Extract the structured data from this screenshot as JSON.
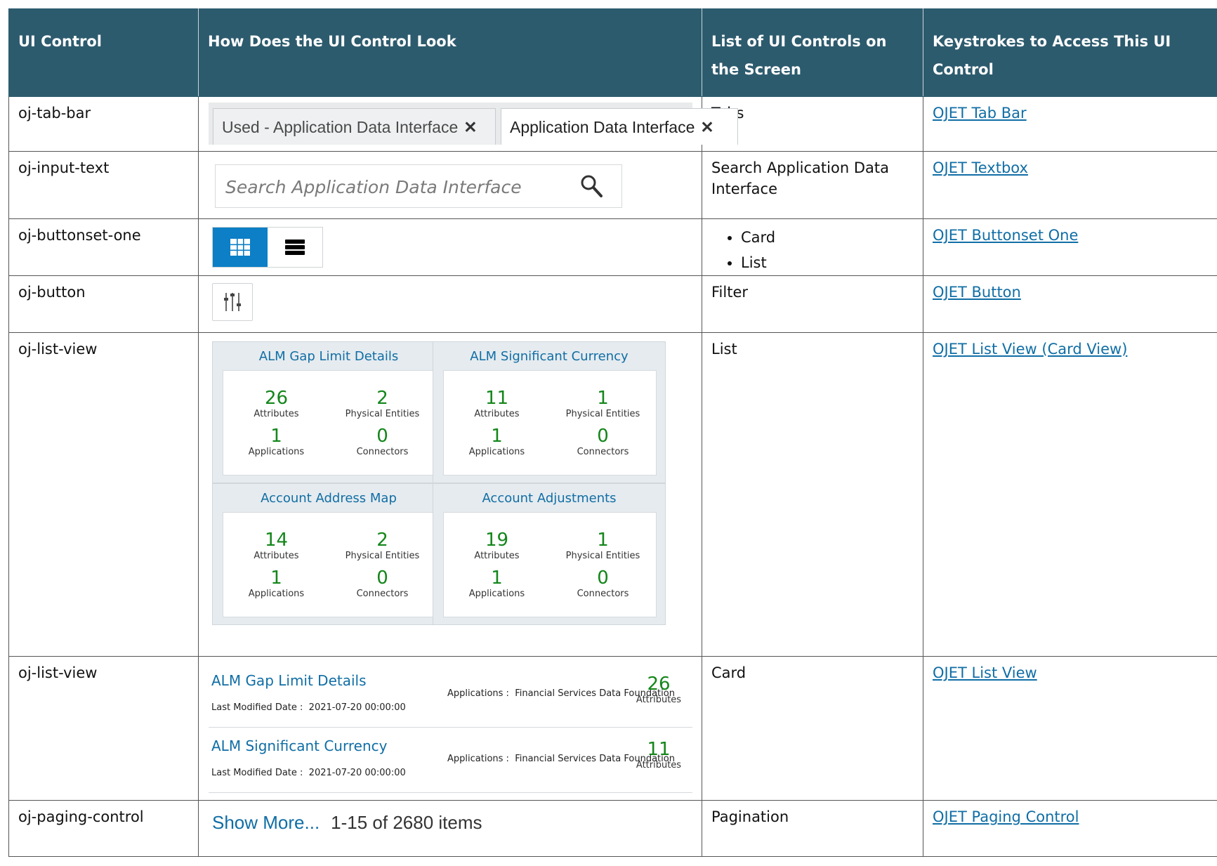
{
  "headers": [
    "UI Control",
    "How Does the UI Control Look",
    "List of UI Controls on the Screen",
    "Keystrokes to Access This UI Control"
  ],
  "rows": [
    {
      "control": "oj-tab-bar",
      "list": "Tabs",
      "link": "OJET Tab Bar"
    },
    {
      "control": "oj-input-text",
      "list": "Search Application Data Interface",
      "link": "OJET Textbox"
    },
    {
      "control": "oj-buttonset-one",
      "list_items": [
        "Card",
        "List"
      ],
      "link": "OJET Buttonset One"
    },
    {
      "control": "oj-button",
      "list": "Filter",
      "link": "OJET Button"
    },
    {
      "control": "oj-list-view",
      "list": "List",
      "link": "OJET List View (Card View)"
    },
    {
      "control": "oj-list-view",
      "list": "Card",
      "link": "OJET List View"
    },
    {
      "control": "oj-paging-control",
      "list": "Pagination",
      "link": "OJET Paging Control"
    }
  ],
  "tabs": [
    {
      "label": "Used - Application Data Interface",
      "close": "✕"
    },
    {
      "label": "Application Data Interface",
      "close": "✕"
    }
  ],
  "search": {
    "placeholder": "Search Application Data Interface",
    "icon": "search-icon"
  },
  "buttonset": {
    "active": "card",
    "icons": [
      "grid-icon",
      "list-icon"
    ],
    "accent": "#0c7fc6"
  },
  "filter": {
    "icon": "sliders-icon"
  },
  "cards": [
    {
      "title": "ALM Gap Limit Details",
      "attributes": "26",
      "physical_entities": "2",
      "applications": "1",
      "connectors": "0"
    },
    {
      "title": "ALM Significant Currency",
      "attributes": "11",
      "physical_entities": "1",
      "applications": "1",
      "connectors": "0"
    },
    {
      "title": "Account Address Map",
      "attributes": "14",
      "physical_entities": "2",
      "applications": "1",
      "connectors": "0"
    },
    {
      "title": "Account Adjustments",
      "attributes": "19",
      "physical_entities": "1",
      "applications": "1",
      "connectors": "0"
    }
  ],
  "card_labels": {
    "attributes": "Attributes",
    "physical_entities": "Physical Entities",
    "applications": "Applications",
    "connectors": "Connectors"
  },
  "list_items": [
    {
      "name": "ALM Gap Limit Details",
      "date_label": "Last Modified Date :",
      "date": "2021-07-20 00:00:00",
      "apps_label": "Applications :",
      "apps": "Financial Services Data Foundation",
      "count": "26",
      "count_label": "Attributes"
    },
    {
      "name": "ALM Significant Currency",
      "date_label": "Last Modified Date :",
      "date": "2021-07-20 00:00:00",
      "apps_label": "Applications :",
      "apps": "Financial Services Data Foundation",
      "count": "11",
      "count_label": "Attributes"
    }
  ],
  "paging": {
    "more": "Show More...",
    "info": "1-15 of 2680 items"
  },
  "colors": {
    "header_bg": "#2d5b6e",
    "link": "#106ea5",
    "stat_green": "#14861b"
  }
}
